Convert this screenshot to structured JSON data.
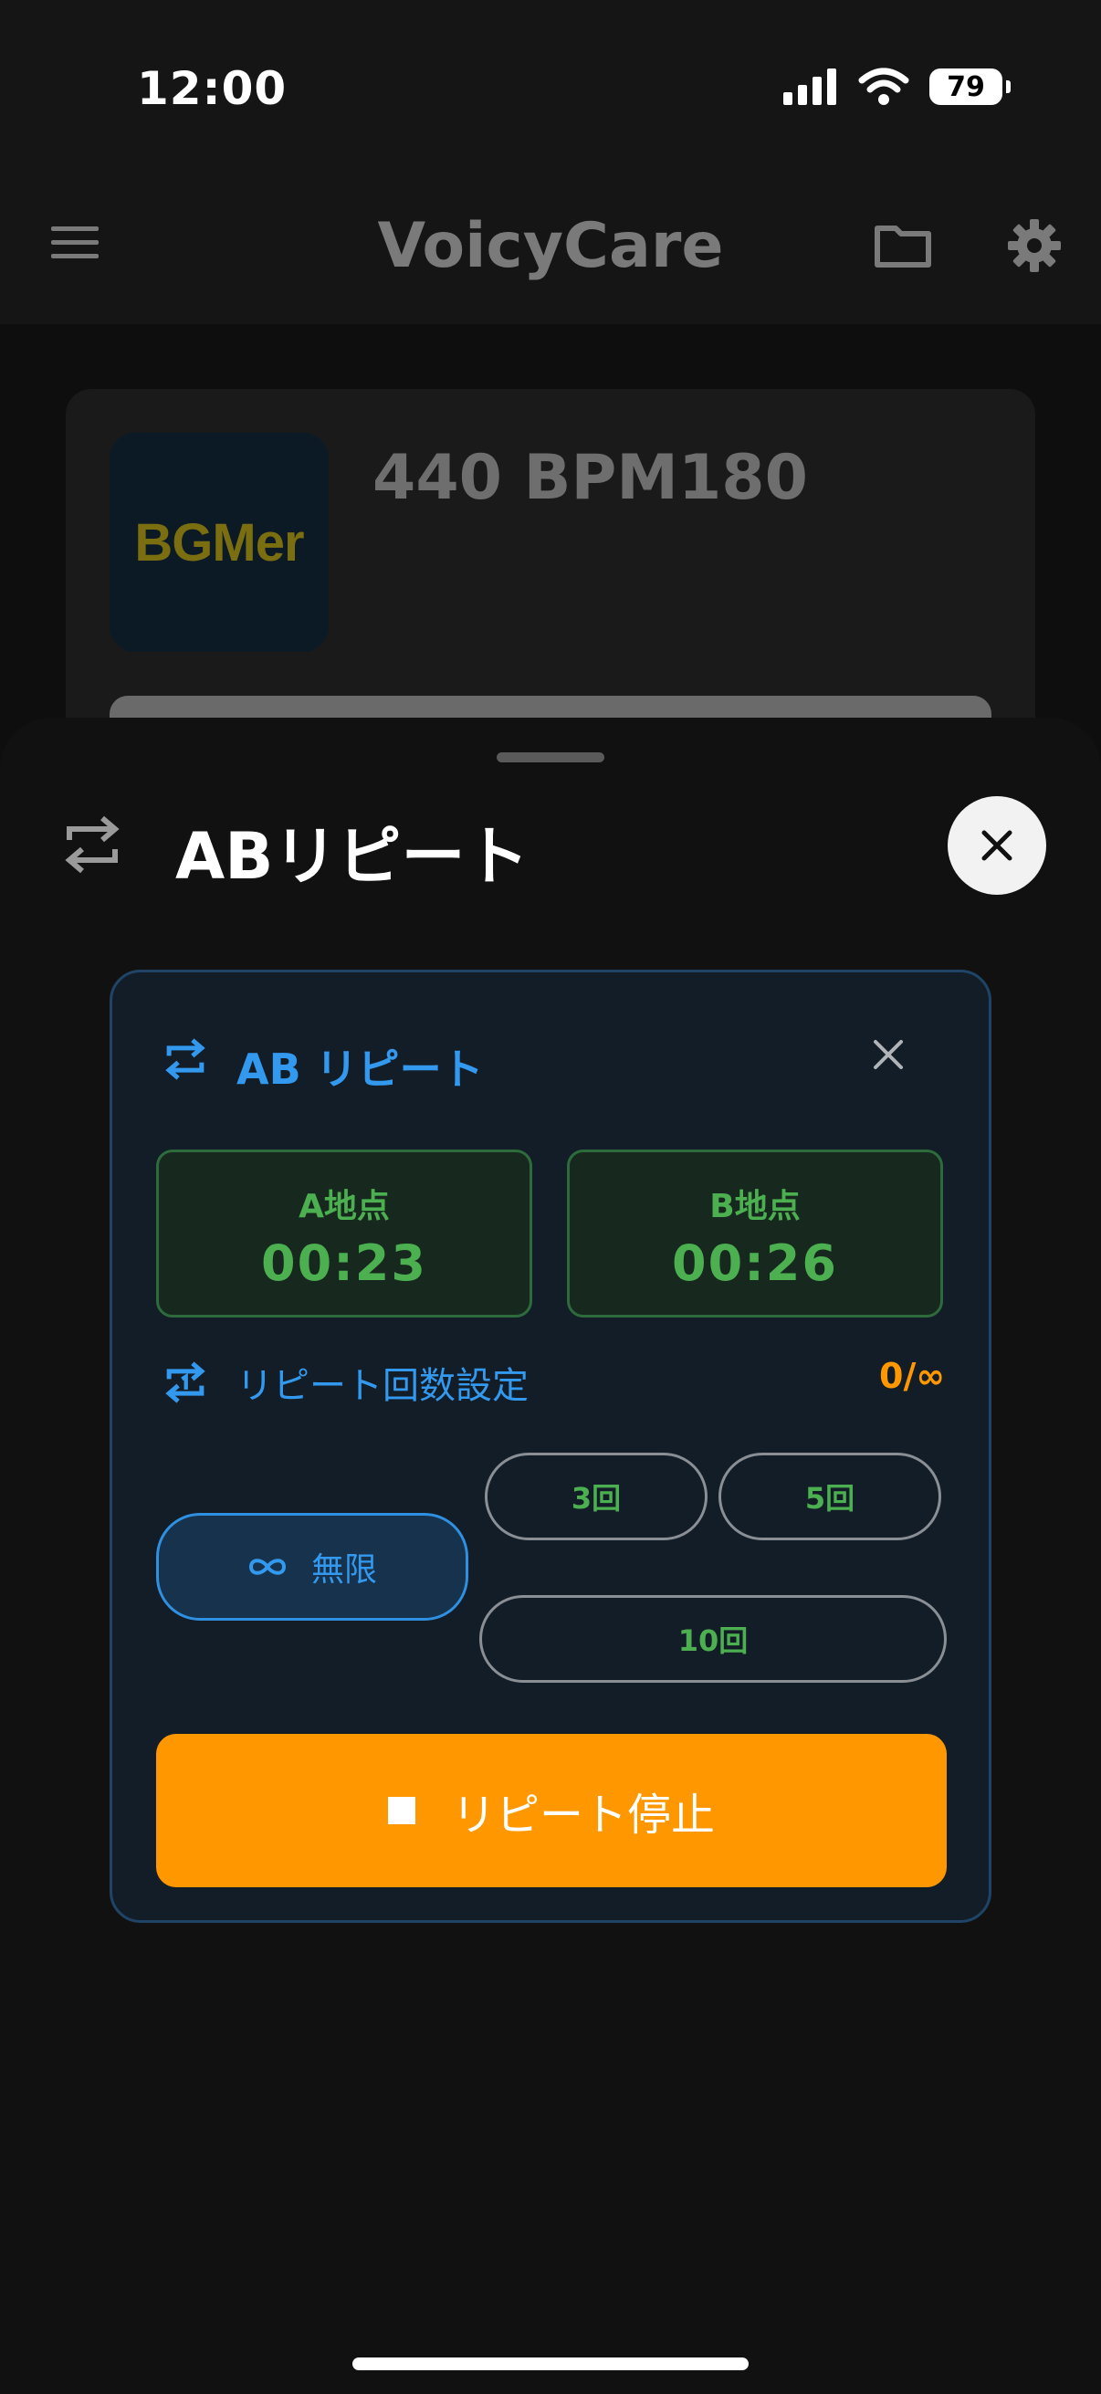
{
  "status_bar": {
    "time": "12:00",
    "battery": "79"
  },
  "header": {
    "title": "VoicyCare"
  },
  "track": {
    "art_text": "BGMer",
    "title": "440 BPM180"
  },
  "sheet": {
    "title": "ABリピート"
  },
  "panel": {
    "title": "AB リピート",
    "point_a": {
      "label": "A地点",
      "time": "00:23"
    },
    "point_b": {
      "label": "B地点",
      "time": "00:26"
    },
    "repeat_label": "リピート回数設定",
    "repeat_count": "0/∞",
    "options": {
      "infinite": "無限",
      "three": "3回",
      "five": "5回",
      "ten": "10回"
    },
    "stop_label": "リピート停止"
  },
  "colors": {
    "accent_blue": "#3399ee",
    "accent_green": "#4caf50",
    "accent_orange": "#ff9800",
    "background": "#0e0e0e"
  },
  "icons": [
    "menu-icon",
    "folder-icon",
    "gear-icon",
    "repeat-icon",
    "close-icon",
    "repeat-one-icon",
    "infinity-icon",
    "stop-icon"
  ]
}
